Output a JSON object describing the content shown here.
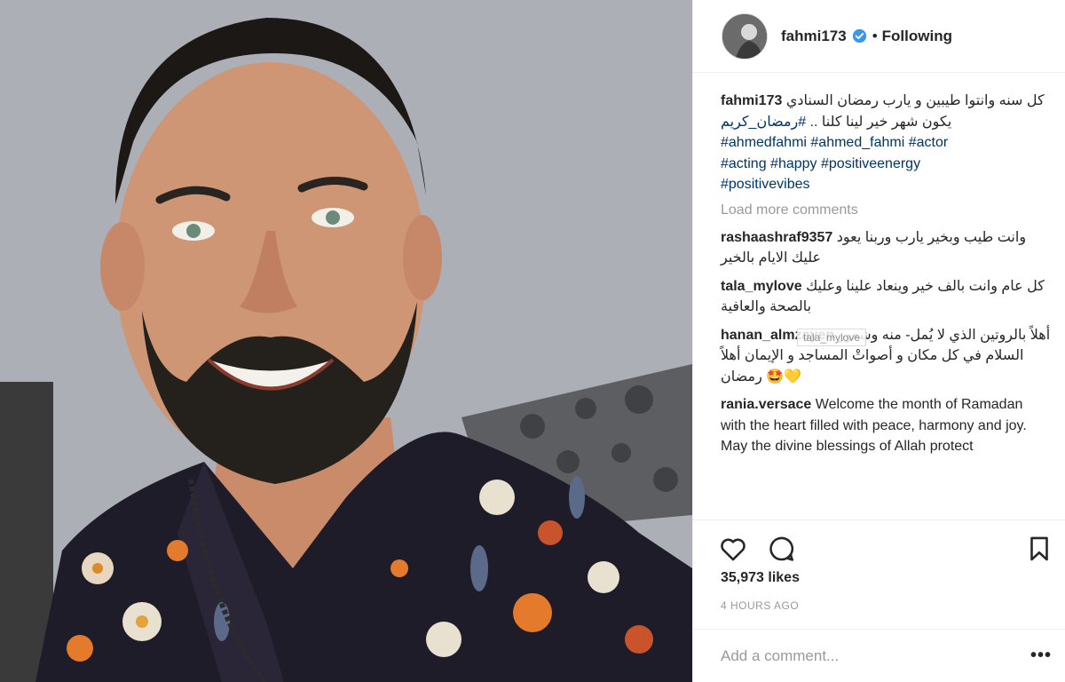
{
  "post": {
    "username": "fahmi173",
    "separator": "•",
    "follow_label": "Following",
    "photo_alt": "Selfie of a smiling bearded man in a floral shirt"
  },
  "caption": {
    "username": "fahmi173",
    "text": "كل سنه وانتوا طيبين و يارب رمضان السنادي يكون شهر خير لينا كلنا ..",
    "hashtags": [
      "#رمضان_كريم",
      "#ahmedfahmi",
      "#ahmed_fahmi",
      "#actor",
      "#acting",
      "#happy",
      "#positiveenergy",
      "#positivevibes"
    ]
  },
  "load_more_label": "Load more comments",
  "comments": [
    {
      "user": "rashaashraf9357",
      "text": "وانت طيب وبخير يارب وربنا يعود عليك الايام بالخير"
    },
    {
      "user": "tala_mylove",
      "text": "كل عام وانت بالف خير وينعاد علينا وعليك بالصحة والعافية"
    },
    {
      "user": "hanan_almzayen",
      "text": "أهلاً بالروتين الذي لا يُمل- منه وشعور السلام في كل مكان و أصواتْ المساجد و الإيمان أهلاً رمضان 🤩💛"
    },
    {
      "user": "rania.versace",
      "text": "Welcome the month of Ramadan with the heart filled with peace, harmony and joy. May the divine blessings of Allah protect"
    }
  ],
  "tooltip": "tala_mylove",
  "likes": "35,973 likes",
  "time_ago": "4 HOURS AGO",
  "add_comment_placeholder": "Add a comment...",
  "more_label": "•••",
  "colors": {
    "link": "#003569",
    "verified": "#3897f0",
    "muted": "#999999"
  },
  "icons": [
    "heart-icon",
    "comment-icon",
    "bookmark-icon",
    "verified-icon"
  ]
}
